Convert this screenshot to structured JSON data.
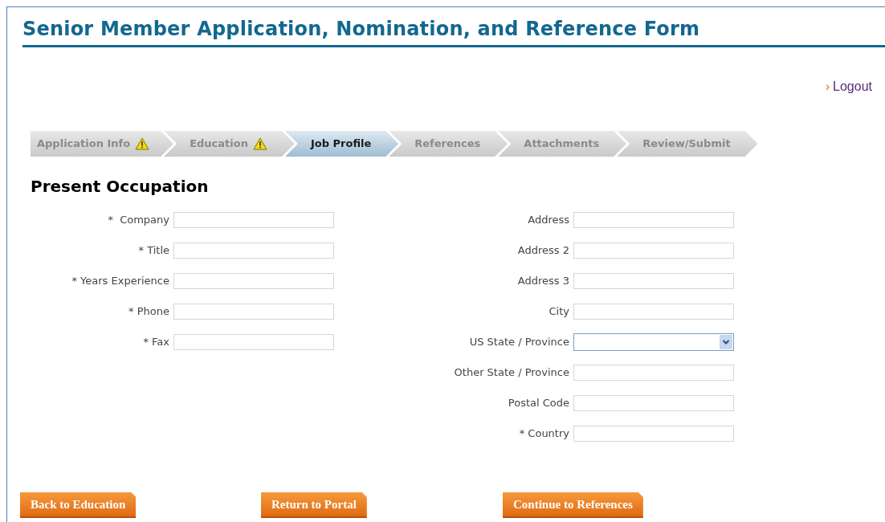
{
  "title": "Senior Member Application, Nomination, and Reference Form",
  "logout": {
    "marker": "›",
    "label": "Logout"
  },
  "steps": [
    {
      "label": "Application Info",
      "warning": true,
      "selected": false
    },
    {
      "label": "Education",
      "warning": true,
      "selected": false
    },
    {
      "label": "Job Profile",
      "warning": false,
      "selected": true
    },
    {
      "label": "References",
      "warning": false,
      "selected": false
    },
    {
      "label": "Attachments",
      "warning": false,
      "selected": false
    },
    {
      "label": "Review/Submit",
      "warning": false,
      "selected": false
    }
  ],
  "section_heading": "Present Occupation",
  "left_fields": [
    {
      "label": "*  Company",
      "kind": "text"
    },
    {
      "label": "* Title",
      "kind": "text"
    },
    {
      "label": "* Years Experience",
      "kind": "text"
    },
    {
      "label": "* Phone",
      "kind": "text"
    },
    {
      "label": "* Fax",
      "kind": "text"
    }
  ],
  "right_fields": [
    {
      "label": "Address",
      "kind": "text"
    },
    {
      "label": "Address 2",
      "kind": "text"
    },
    {
      "label": "Address 3",
      "kind": "text"
    },
    {
      "label": "City",
      "kind": "text"
    },
    {
      "label": "US State / Province",
      "kind": "select"
    },
    {
      "label": "Other State / Province",
      "kind": "text"
    },
    {
      "label": "Postal Code",
      "kind": "text"
    },
    {
      "label": "* Country",
      "kind": "text"
    }
  ],
  "buttons": [
    "Back to Education",
    "Return to Portal",
    "Continue to References"
  ]
}
